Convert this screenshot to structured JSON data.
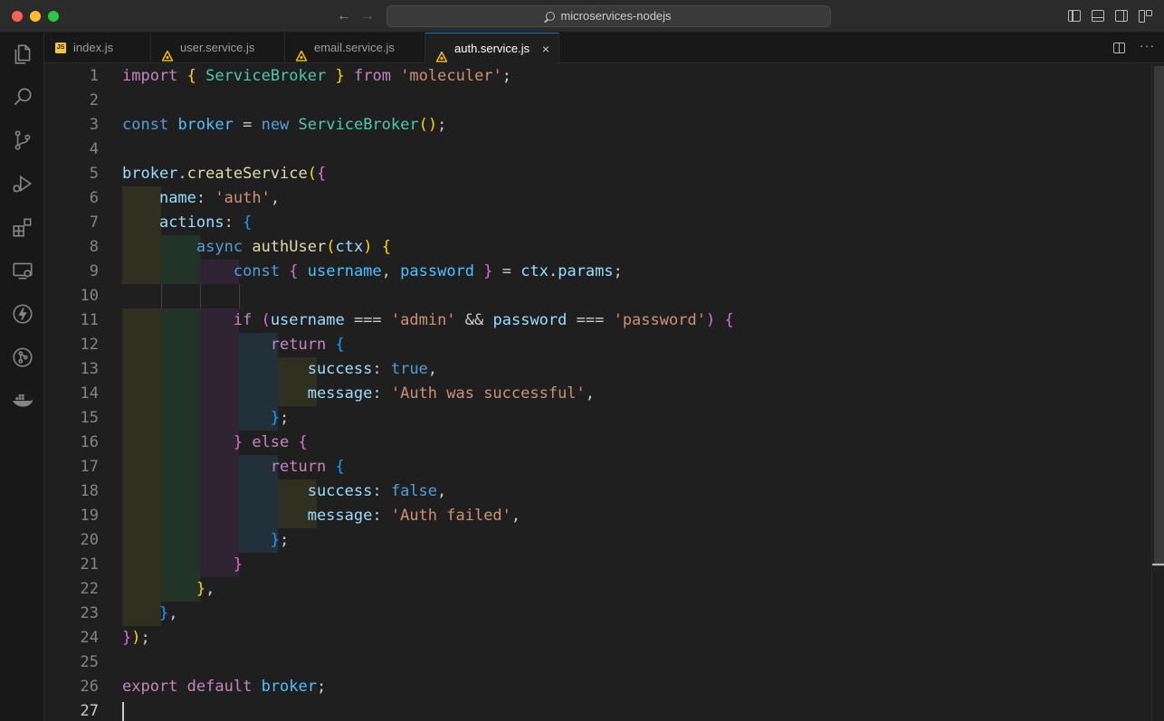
{
  "window": {
    "search_text": "microservices-nodejs",
    "nav_back": "←",
    "nav_forward": "→"
  },
  "tabs": [
    {
      "label": "index.js",
      "icon": "javascript-file-icon",
      "active": false
    },
    {
      "label": "user.service.js",
      "icon": "moleculer-file-icon",
      "active": false
    },
    {
      "label": "email.service.js",
      "icon": "moleculer-file-icon",
      "active": false
    },
    {
      "label": "auth.service.js",
      "icon": "moleculer-file-icon",
      "active": true
    }
  ],
  "tab_close": "×",
  "tab_more": "···",
  "js_icon_text": "JS",
  "activity_bar": [
    "explorer-icon",
    "search-icon",
    "source-control-icon",
    "run-debug-icon",
    "extensions-icon",
    "remote-explorer-icon",
    "thunder-client-icon",
    "gitlens-icon",
    "docker-icon"
  ],
  "editor": {
    "current_line": "27",
    "lines": [
      {
        "n": "1",
        "tokens": [
          [
            "kw",
            "import"
          ],
          [
            "pl",
            " "
          ],
          [
            "p1",
            "{"
          ],
          [
            "pl",
            " "
          ],
          [
            "cls",
            "ServiceBroker"
          ],
          [
            "pl",
            " "
          ],
          [
            "p1",
            "}"
          ],
          [
            "pl",
            " "
          ],
          [
            "kw",
            "from"
          ],
          [
            "pl",
            " "
          ],
          [
            "str",
            "'moleculer'"
          ],
          [
            "pl",
            ";"
          ]
        ]
      },
      {
        "n": "2",
        "tokens": []
      },
      {
        "n": "3",
        "tokens": [
          [
            "kb",
            "const"
          ],
          [
            "pl",
            " "
          ],
          [
            "var",
            "broker"
          ],
          [
            "pl",
            " = "
          ],
          [
            "kb",
            "new"
          ],
          [
            "pl",
            " "
          ],
          [
            "cls",
            "ServiceBroker"
          ],
          [
            "p1",
            "()"
          ],
          [
            "pl",
            ";"
          ]
        ]
      },
      {
        "n": "4",
        "tokens": []
      },
      {
        "n": "5",
        "tokens": [
          [
            "prop",
            "broker"
          ],
          [
            "pl",
            "."
          ],
          [
            "fn",
            "createService"
          ],
          [
            "p1",
            "("
          ],
          [
            "p2",
            "{"
          ]
        ]
      },
      {
        "n": "6",
        "tokens": [
          [
            "pl",
            "    "
          ],
          [
            "prop",
            "name"
          ],
          [
            "pl",
            ": "
          ],
          [
            "str",
            "'auth'"
          ],
          [
            "pl",
            ","
          ]
        ]
      },
      {
        "n": "7",
        "tokens": [
          [
            "pl",
            "    "
          ],
          [
            "prop",
            "actions"
          ],
          [
            "pl",
            ": "
          ],
          [
            "p3",
            "{"
          ]
        ]
      },
      {
        "n": "8",
        "tokens": [
          [
            "pl",
            "        "
          ],
          [
            "kb",
            "async"
          ],
          [
            "pl",
            " "
          ],
          [
            "fn",
            "authUser"
          ],
          [
            "p1",
            "("
          ],
          [
            "prop",
            "ctx"
          ],
          [
            "p1",
            ")"
          ],
          [
            "pl",
            " "
          ],
          [
            "p1",
            "{"
          ]
        ]
      },
      {
        "n": "9",
        "tokens": [
          [
            "pl",
            "            "
          ],
          [
            "kb",
            "const"
          ],
          [
            "pl",
            " "
          ],
          [
            "p2",
            "{"
          ],
          [
            "pl",
            " "
          ],
          [
            "var",
            "username"
          ],
          [
            "pl",
            ", "
          ],
          [
            "var",
            "password"
          ],
          [
            "pl",
            " "
          ],
          [
            "p2",
            "}"
          ],
          [
            "pl",
            " = "
          ],
          [
            "prop",
            "ctx"
          ],
          [
            "pl",
            "."
          ],
          [
            "prop",
            "params"
          ],
          [
            "pl",
            ";"
          ]
        ]
      },
      {
        "n": "10",
        "tokens": []
      },
      {
        "n": "11",
        "tokens": [
          [
            "pl",
            "            "
          ],
          [
            "kw",
            "if"
          ],
          [
            "pl",
            " "
          ],
          [
            "p2",
            "("
          ],
          [
            "prop",
            "username"
          ],
          [
            "pl",
            " === "
          ],
          [
            "str",
            "'admin'"
          ],
          [
            "pl",
            " && "
          ],
          [
            "prop",
            "password"
          ],
          [
            "pl",
            " === "
          ],
          [
            "str",
            "'password'"
          ],
          [
            "p2",
            ")"
          ],
          [
            "pl",
            " "
          ],
          [
            "p2",
            "{"
          ]
        ]
      },
      {
        "n": "12",
        "tokens": [
          [
            "pl",
            "                "
          ],
          [
            "kw",
            "return"
          ],
          [
            "pl",
            " "
          ],
          [
            "p3",
            "{"
          ]
        ]
      },
      {
        "n": "13",
        "tokens": [
          [
            "pl",
            "                    "
          ],
          [
            "prop",
            "success"
          ],
          [
            "pl",
            ": "
          ],
          [
            "kb",
            "true"
          ],
          [
            "pl",
            ","
          ]
        ]
      },
      {
        "n": "14",
        "tokens": [
          [
            "pl",
            "                    "
          ],
          [
            "prop",
            "message"
          ],
          [
            "pl",
            ": "
          ],
          [
            "str",
            "'Auth was successful'"
          ],
          [
            "pl",
            ","
          ]
        ]
      },
      {
        "n": "15",
        "tokens": [
          [
            "pl",
            "                "
          ],
          [
            "p3",
            "}"
          ],
          [
            "pl",
            ";"
          ]
        ]
      },
      {
        "n": "16",
        "tokens": [
          [
            "pl",
            "            "
          ],
          [
            "p2",
            "}"
          ],
          [
            "pl",
            " "
          ],
          [
            "kw",
            "else"
          ],
          [
            "pl",
            " "
          ],
          [
            "p2",
            "{"
          ]
        ]
      },
      {
        "n": "17",
        "tokens": [
          [
            "pl",
            "                "
          ],
          [
            "kw",
            "return"
          ],
          [
            "pl",
            " "
          ],
          [
            "p3",
            "{"
          ]
        ]
      },
      {
        "n": "18",
        "tokens": [
          [
            "pl",
            "                    "
          ],
          [
            "prop",
            "success"
          ],
          [
            "pl",
            ": "
          ],
          [
            "kb",
            "false"
          ],
          [
            "pl",
            ","
          ]
        ]
      },
      {
        "n": "19",
        "tokens": [
          [
            "pl",
            "                    "
          ],
          [
            "prop",
            "message"
          ],
          [
            "pl",
            ": "
          ],
          [
            "str",
            "'Auth failed'"
          ],
          [
            "pl",
            ","
          ]
        ]
      },
      {
        "n": "20",
        "tokens": [
          [
            "pl",
            "                "
          ],
          [
            "p3",
            "}"
          ],
          [
            "pl",
            ";"
          ]
        ]
      },
      {
        "n": "21",
        "tokens": [
          [
            "pl",
            "            "
          ],
          [
            "p2",
            "}"
          ]
        ]
      },
      {
        "n": "22",
        "tokens": [
          [
            "pl",
            "        "
          ],
          [
            "p1",
            "}"
          ],
          [
            "pl",
            ","
          ]
        ]
      },
      {
        "n": "23",
        "tokens": [
          [
            "pl",
            "    "
          ],
          [
            "p3",
            "}"
          ],
          [
            "pl",
            ","
          ]
        ]
      },
      {
        "n": "24",
        "tokens": [
          [
            "p2",
            "}"
          ],
          [
            "p1",
            ")"
          ],
          [
            "pl",
            ";"
          ]
        ]
      },
      {
        "n": "25",
        "tokens": []
      },
      {
        "n": "26",
        "tokens": [
          [
            "kw",
            "export"
          ],
          [
            "pl",
            " "
          ],
          [
            "kw",
            "default"
          ],
          [
            "pl",
            " "
          ],
          [
            "var",
            "broker"
          ],
          [
            "pl",
            ";"
          ]
        ]
      },
      {
        "n": "27",
        "tokens": []
      }
    ]
  },
  "colors": {
    "accent": "#0078d4",
    "editor_bg": "#1f1f1f",
    "activity_bg": "#181818",
    "indent_yellow": "#303020",
    "indent_green": "#223328",
    "indent_purple": "#302333",
    "indent_blue": "#22303a"
  }
}
